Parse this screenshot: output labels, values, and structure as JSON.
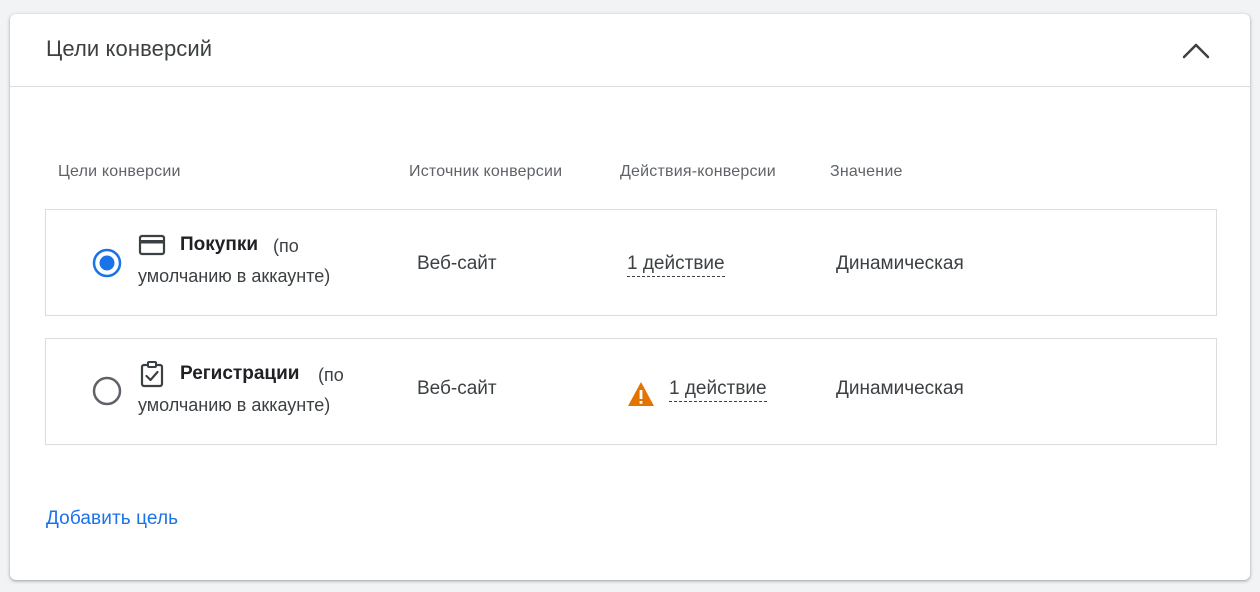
{
  "card": {
    "title": "Цели конверсий",
    "collapse_icon": "chevron-up-icon"
  },
  "table": {
    "headers": {
      "goal": "Цели конверсии",
      "source": "Источник конверсии",
      "actions": "Действия-конверсии",
      "value": "Значение"
    },
    "rows": [
      {
        "selected": true,
        "icon": "credit-card-icon",
        "name": "Покупки",
        "note_part1": "(по",
        "note_part2": "умолчанию в аккаунте)",
        "source": "Веб-сайт",
        "actions": "1 действие",
        "has_warning": false,
        "value": "Динамическая"
      },
      {
        "selected": false,
        "icon": "clipboard-check-icon",
        "name": "Регистрации",
        "note_part1": "(по",
        "note_part2": "умолчанию в аккаунте)",
        "source": "Веб-сайт",
        "actions": "1 действие",
        "has_warning": true,
        "warning_icon": "warning-icon",
        "value": "Динамическая"
      }
    ]
  },
  "add_goal_label": "Добавить цель",
  "colors": {
    "accent": "#1a73e8",
    "warning": "#e37400",
    "border": "#dadce0"
  }
}
